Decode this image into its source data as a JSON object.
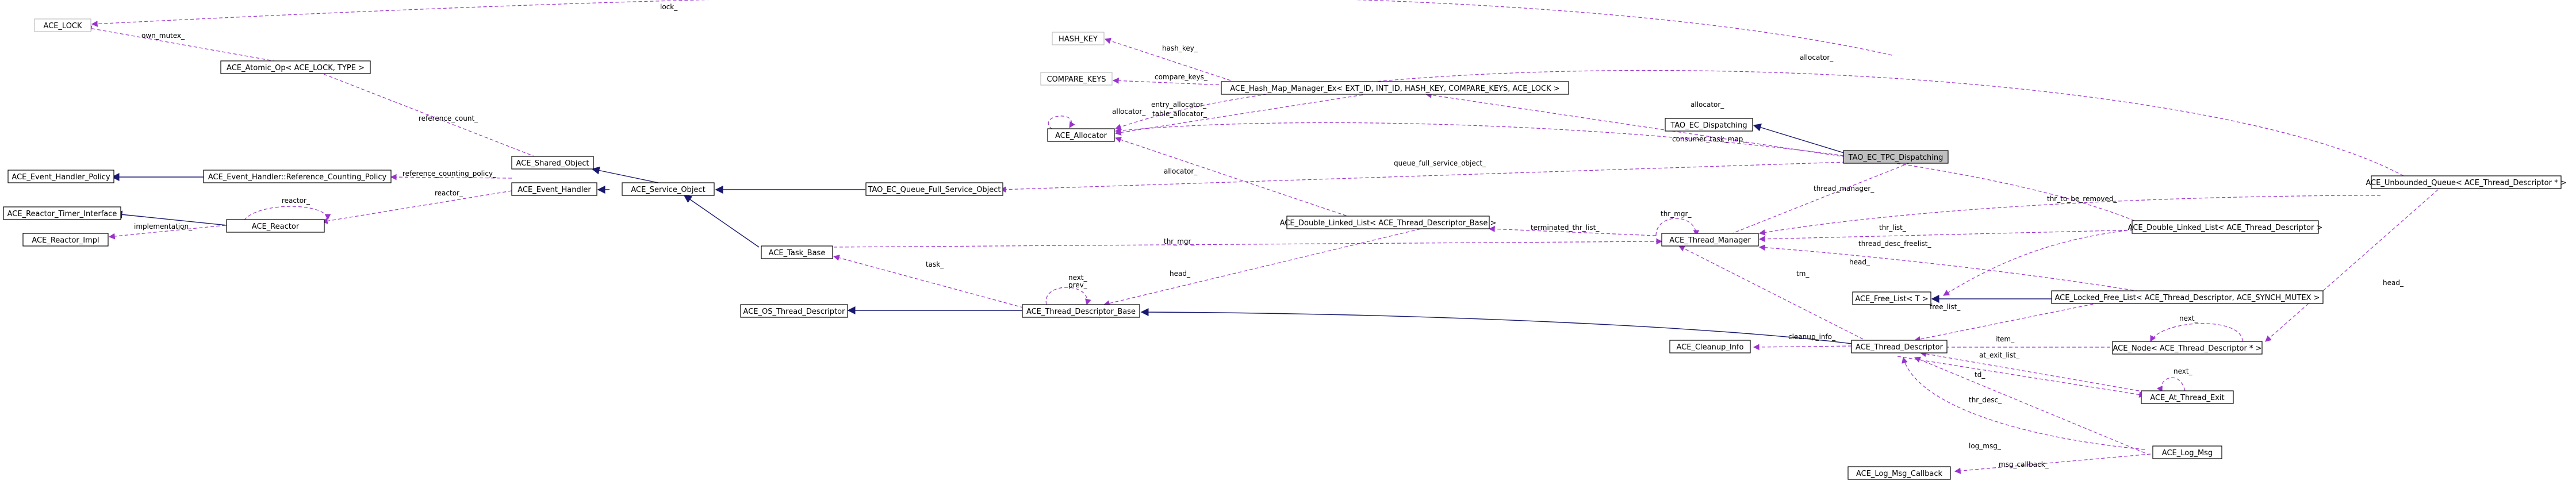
{
  "colors": {
    "usage_edge": "#9a32cd",
    "inherit_edge": "#191970",
    "focus_fill": "#bfbfbf",
    "faded_border": "#bfbfbf"
  },
  "nodes": {
    "ace_lock": "ACE_LOCK",
    "atomic_op": "ACE_Atomic_Op< ACE_LOCK, TYPE >",
    "hash_key": "HASH_KEY",
    "compare_keys": "COMPARE_KEYS",
    "hash_map_manager": "ACE_Hash_Map_Manager_Ex< EXT_ID, INT_ID, HASH_KEY, COMPARE_KEYS, ACE_LOCK >",
    "allocator": "ACE_Allocator",
    "tao_ec_dispatching": "TAO_EC_Dispatching",
    "tao_ec_tpc_dispatching": "TAO_EC_TPC_Dispatching",
    "event_handler_policy": "ACE_Event_Handler_Policy",
    "ref_counting_policy": "ACE_Event_Handler::Reference_Counting_Policy",
    "shared_object": "ACE_Shared_Object",
    "event_handler": "ACE_Event_Handler",
    "service_object": "ACE_Service_Object",
    "queue_full_service_object": "TAO_EC_Queue_Full_Service_Object",
    "reactor_timer_interface": "ACE_Reactor_Timer_Interface",
    "reactor": "ACE_Reactor",
    "reactor_impl": "ACE_Reactor_Impl",
    "task_base": "ACE_Task_Base",
    "dll_descriptor_base": "ACE_Double_Linked_List< ACE_Thread_Descriptor_Base >",
    "thread_manager": "ACE_Thread_Manager",
    "dll_descriptor": "ACE_Double_Linked_List< ACE_Thread_Descriptor >",
    "unbounded_queue": "ACE_Unbounded_Queue< ACE_Thread_Descriptor * >",
    "os_thread_descriptor": "ACE_OS_Thread_Descriptor",
    "thread_descriptor_base": "ACE_Thread_Descriptor_Base",
    "free_list": "ACE_Free_List< T >",
    "locked_free_list": "ACE_Locked_Free_List< ACE_Thread_Descriptor, ACE_SYNCH_MUTEX >",
    "cleanup_info": "ACE_Cleanup_Info",
    "thread_descriptor": "ACE_Thread_Descriptor",
    "node_descriptor": "ACE_Node< ACE_Thread_Descriptor * >",
    "at_thread_exit": "ACE_At_Thread_Exit",
    "log_msg": "ACE_Log_Msg",
    "log_msg_callback": "ACE_Log_Msg_Callback"
  },
  "edge_labels": {
    "lock": "lock_",
    "own_mutex": "own_mutex_",
    "hash_key": "hash_key_",
    "compare_keys": "compare_keys_",
    "allocator_top": "allocator_",
    "allocator_mid": "allocator_",
    "allocator_self": "allocator_",
    "entry_allocator": "entry_allocator_",
    "table_allocator": "table_allocator_",
    "consumer_task_map": "consumer_task_map_",
    "reference_count": "reference_count_",
    "reference_counting_policy": "reference_counting_policy_",
    "reactor_top": "reactor_",
    "reactor_mid": "reactor_",
    "implementation": "implementation_",
    "queue_full_service_object": "queue_full_service_object_",
    "allocator_dll": "allocator_",
    "thread_manager": "thread_manager_",
    "thr_mgr_self": "thr_mgr_",
    "thr_mgr_task": "thr_mgr_",
    "terminated_thr_list": "terminated_thr_list_",
    "thr_to_be_removed": "thr_to_be_removed_",
    "thr_list": "thr_list_",
    "thread_desc_freelist": "thread_desc_freelist_",
    "head_top": "head_",
    "head_dll": "head_",
    "head_queue": "head_",
    "task": "task_",
    "next_prev": "next_\nprev_",
    "tm": "tm_",
    "free_list": "free_list_",
    "next_node": "next_",
    "item": "item_",
    "cleanup_info": "cleanup_info_",
    "at_exit_list": "at_exit_list_",
    "td": "td_",
    "next_exit": "next_",
    "thr_desc": "thr_desc_",
    "log_msg": "log_msg_",
    "msg_callback": "msg_callback_"
  }
}
